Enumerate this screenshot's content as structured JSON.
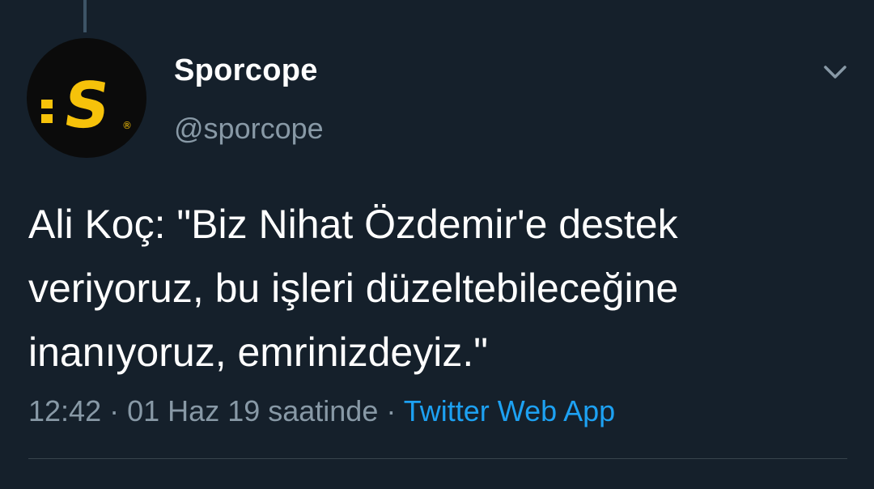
{
  "tweet": {
    "display_name": "Sporcope",
    "handle": "@sporcope",
    "text": "Ali Koç: \"Biz Nihat Özdemir'e destek veriyoruz, bu işleri düzeltebileceğine inanıyoruz, emrinizdeyiz.\"",
    "time": "12:42",
    "date": "01 Haz 19 saatinde",
    "separator": "·",
    "source": "Twitter Web App"
  },
  "avatar": {
    "icon": "sporcope-logo",
    "logo_letter": "S",
    "logo_mark": "®"
  },
  "icons": {
    "menu": "chevron-down-icon"
  },
  "colors": {
    "background": "#15202b",
    "text_primary": "#ffffff",
    "text_secondary": "#8899a6",
    "link": "#1da1f2",
    "logo_yellow": "#f6c20a",
    "divider": "#38444d"
  }
}
